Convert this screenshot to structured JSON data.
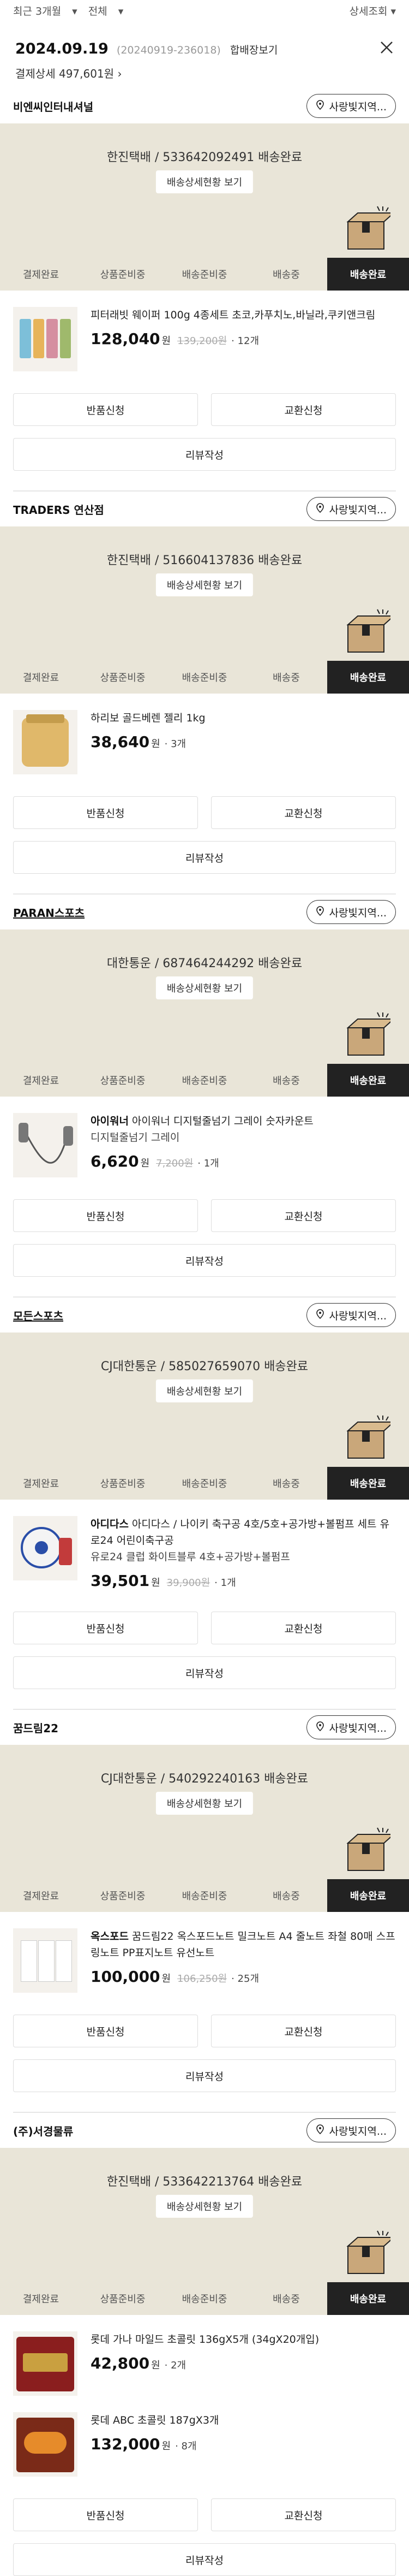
{
  "filters": {
    "period": "최근 3개월",
    "type": "전체",
    "detail_search": "상세조회"
  },
  "order": {
    "date": "2024.09.19",
    "order_no": "(20240919-236018)",
    "merged": "합배장보기",
    "payment_label": "결제상세",
    "payment_amount": "497,601원"
  },
  "steps": [
    "결제완료",
    "상품준비중",
    "배송준비중",
    "배송중",
    "배송완료"
  ],
  "labels": {
    "contact": "사랑빛지역...",
    "detail": "배송상세현황 보기",
    "return": "반품신청",
    "exchange": "교환신청",
    "review": "리뷰작성",
    "won": "원"
  },
  "shipments": [
    {
      "seller": "비엔씨인터내셔널",
      "status": "한진택배 / 533642092491 배송완료",
      "products": [
        {
          "brand": "",
          "name": "피터래빗 웨이퍼 100g 4종세트 초코,카푸치노,바닐라,쿠키앤크림",
          "option": "",
          "price": "128,040",
          "orig": "139,200원",
          "qty": "12개",
          "thumb": "wafer"
        }
      ]
    },
    {
      "seller": "TRADERS 연산점",
      "status": "한진택배 / 516604137836 배송완료",
      "products": [
        {
          "brand": "",
          "name": "하리보 골드베렌 젤리 1kg",
          "option": "",
          "price": "38,640",
          "orig": "",
          "qty": "3개",
          "thumb": "jelly"
        }
      ]
    },
    {
      "seller": "PARAN스포츠",
      "status": "대한통운 / 687464244292 배송완료",
      "products": [
        {
          "brand": "아이워너",
          "name": "아이워너 디지털줄넘기 그레이 숫자카운트",
          "option": "디지털줄넘기 그레이",
          "price": "6,620",
          "orig": "7,200원",
          "qty": "1개",
          "thumb": "rope"
        }
      ]
    },
    {
      "seller": "모든스포츠",
      "status": "CJ대한통운 / 585027659070 배송완료",
      "products": [
        {
          "brand": "아디다스",
          "name": "아디다스 / 나이키 축구공 4호/5호+공가방+볼펌프 세트 유로24 어린이축구공",
          "option": "유로24 클럽 화이트블루 4호+공가방+볼펌프",
          "price": "39,501",
          "orig": "39,900원",
          "qty": "1개",
          "thumb": "ball"
        }
      ]
    },
    {
      "seller": "꿈드림22",
      "status": "CJ대한통운 / 540292240163 배송완료",
      "products": [
        {
          "brand": "옥스포드",
          "name": "꿈드림22 옥스포드노트 밀크노트 A4 줄노트 좌철 80매 스프링노트 PP표지노트 유선노트",
          "option": "",
          "price": "100,000",
          "orig": "106,250원",
          "qty": "25개",
          "thumb": "note"
        }
      ]
    },
    {
      "seller": "(주)서경물류",
      "status": "한진택배 / 533642213764 배송완료",
      "products": [
        {
          "brand": "",
          "name": "롯데 가나 마일드 초콜릿 136gX5개 (34gX20개입)",
          "option": "",
          "price": "42,800",
          "orig": "",
          "qty": "2개",
          "thumb": "ghana"
        },
        {
          "brand": "",
          "name": "롯데 ABC 초콜릿 187gX3개",
          "option": "",
          "price": "132,000",
          "orig": "",
          "qty": "8개",
          "thumb": "abc"
        }
      ]
    }
  ]
}
